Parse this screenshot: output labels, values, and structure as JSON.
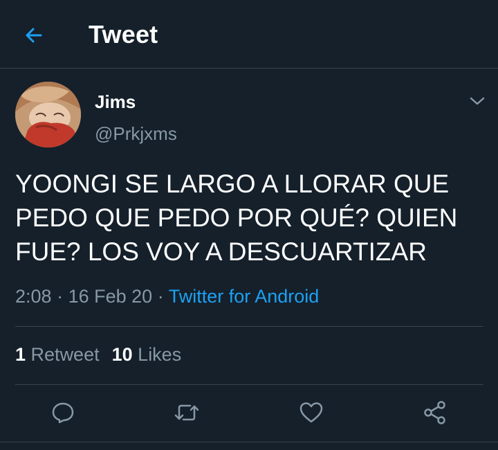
{
  "header": {
    "title": "Tweet",
    "back_icon": "arrow-left-icon",
    "accent_color": "#1da1f2"
  },
  "tweet": {
    "author": {
      "display_name": "Jims",
      "handle": "@Prkjxms"
    },
    "text": "YOONGI SE LARGO A LLORAR QUE PEDO QUE PEDO POR QUÉ? QUIEN FUE? LOS VOY A DESCUARTIZAR",
    "time": "2:08",
    "date": "16 Feb 20",
    "separator": "·",
    "source": "Twitter for Android",
    "menu_icon": "chevron-down-icon"
  },
  "stats": {
    "retweets_count": "1",
    "retweets_label": "Retweet",
    "likes_count": "10",
    "likes_label": "Likes"
  },
  "actions": [
    "reply-icon",
    "retweet-icon",
    "like-icon",
    "share-icon"
  ],
  "colors": {
    "background": "#15202b",
    "secondary_text": "#8899a6",
    "border": "#38444d",
    "link": "#1da1f2"
  }
}
